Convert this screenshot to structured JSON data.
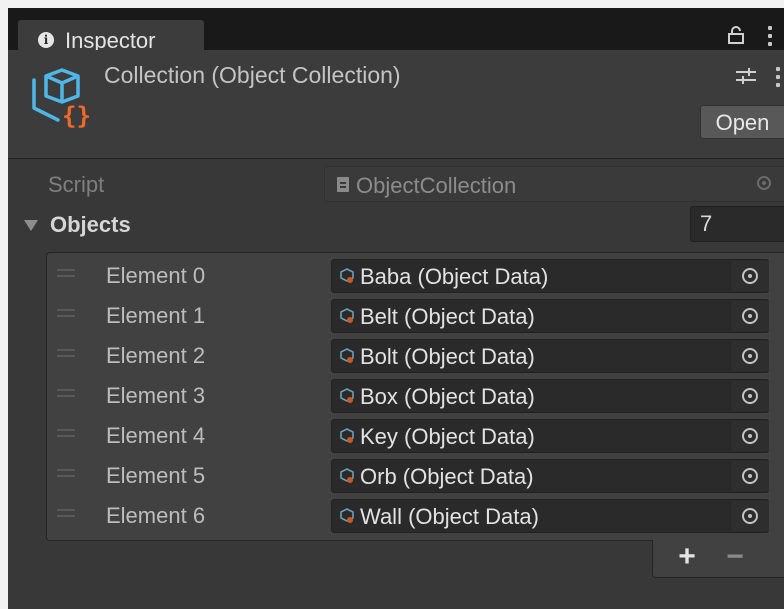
{
  "tab": {
    "title": "Inspector",
    "icon": "info-icon"
  },
  "header": {
    "title": "Collection (Object Collection)",
    "open_label": "Open",
    "icon": "scriptable-object-asset-icon"
  },
  "script": {
    "label": "Script",
    "value": "ObjectCollection"
  },
  "objects": {
    "label": "Objects",
    "size": "7",
    "elements": [
      {
        "label": "Element 0",
        "value": "Baba (Object Data)"
      },
      {
        "label": "Element 1",
        "value": "Belt (Object Data)"
      },
      {
        "label": "Element 2",
        "value": "Bolt (Object Data)"
      },
      {
        "label": "Element 3",
        "value": "Box (Object Data)"
      },
      {
        "label": "Element 4",
        "value": "Key (Object Data)"
      },
      {
        "label": "Element 5",
        "value": "Orb (Object Data)"
      },
      {
        "label": "Element 6",
        "value": "Wall (Object Data)"
      }
    ]
  },
  "footer": {
    "add_label": "+",
    "remove_label": "−"
  },
  "colors": {
    "asset_icon_blue": "#4fb6e8",
    "asset_icon_orange": "#f06a2a",
    "panel_bg": "#383838"
  }
}
